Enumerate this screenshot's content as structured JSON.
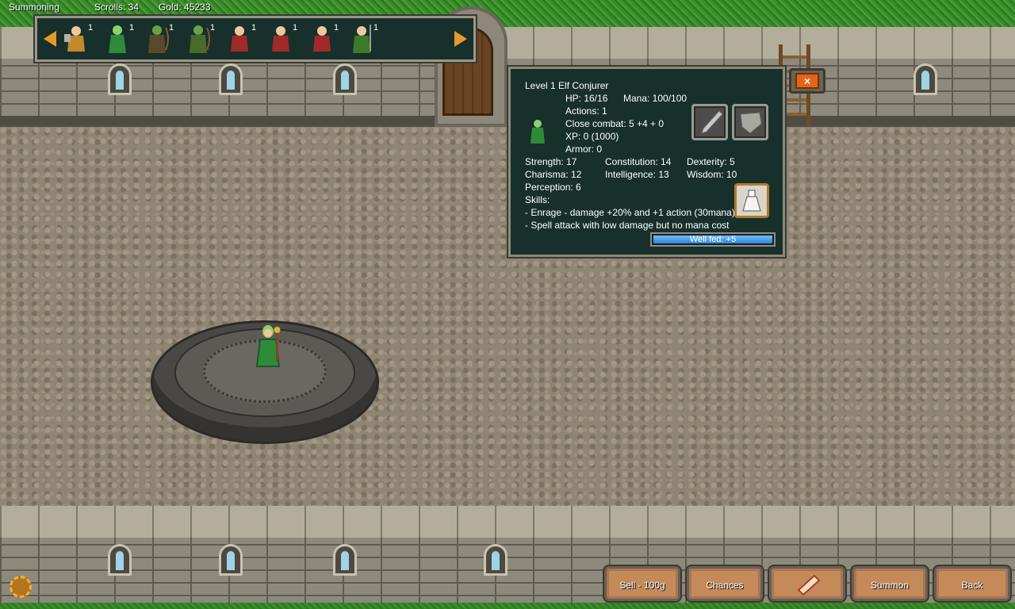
{
  "status_bar": {
    "mode": "Summoning",
    "scrolls": "Scrolls: 34",
    "gold": "Gold: 45233"
  },
  "roster": {
    "prev_icon": "arrow-left-icon",
    "next_icon": "arrow-right-icon",
    "units": [
      {
        "icon": "dwarf-warrior-icon",
        "count": "1"
      },
      {
        "icon": "elf-conjurer-icon",
        "count": "1"
      },
      {
        "icon": "orc-archer-icon",
        "count": "1"
      },
      {
        "icon": "orc-archer-icon",
        "count": "1"
      },
      {
        "icon": "dwarf-miner-icon",
        "count": "1"
      },
      {
        "icon": "dwarf-miner-icon",
        "count": "1"
      },
      {
        "icon": "dwarf-miner-icon",
        "count": "1"
      },
      {
        "icon": "elf-spearman-icon",
        "count": "1"
      }
    ]
  },
  "unit_info": {
    "title": "Level 1 Elf Conjurer",
    "hp": "HP: 16/16",
    "mana": "Mana: 100/100",
    "actions": "Actions: 1",
    "close_combat": "Close combat: 5 +4 + 0",
    "xp": "XP: 0 (1000)",
    "armor": "Armor: 0",
    "strength": "Strength: 17",
    "constitution": "Constitution: 14",
    "dexterity": "Dexterity: 5",
    "charisma": "Charisma: 12",
    "intelligence": "Intelligence: 13",
    "wisdom": "Wisdom: 10",
    "perception": "Perception: 6",
    "skills_label": "Skills:",
    "skill_1": "- Enrage - damage +20% and +1 action (30mana)",
    "skill_2": "- Spell attack with low damage but no mana cost",
    "well_fed": "Well fed: +5",
    "well_fed_level": 1.0,
    "weapon_icon": "sword-icon",
    "armor_icon": "shield-icon",
    "item_icon": "potion-icon"
  },
  "close_button": {
    "label": "×",
    "icon": "close-icon"
  },
  "buttons": {
    "sell": "Sell - 100g",
    "chances": "Chances",
    "scroll_icon": "scroll-icon",
    "summon": "Summon",
    "back": "Back"
  },
  "settings": {
    "icon": "gear-icon"
  }
}
